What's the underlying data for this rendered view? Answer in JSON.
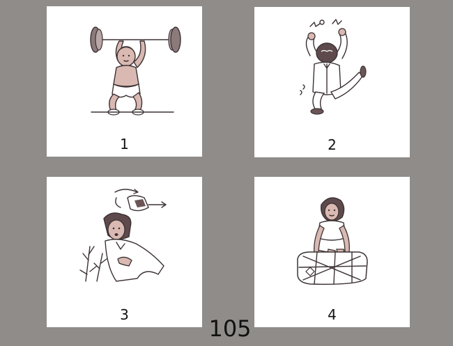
{
  "cards": [
    {
      "number": "1",
      "icon": "baby-weightlifter-illustration"
    },
    {
      "number": "2",
      "icon": "angry-man-jumping-illustration"
    },
    {
      "number": "3",
      "icon": "man-losing-hat-illustration"
    },
    {
      "number": "4",
      "icon": "girl-sitting-cushion-illustration"
    }
  ],
  "page_number": "105",
  "colors": {
    "background": "#8f8c89",
    "card": "#ffffff",
    "ink": "#3b3133"
  }
}
